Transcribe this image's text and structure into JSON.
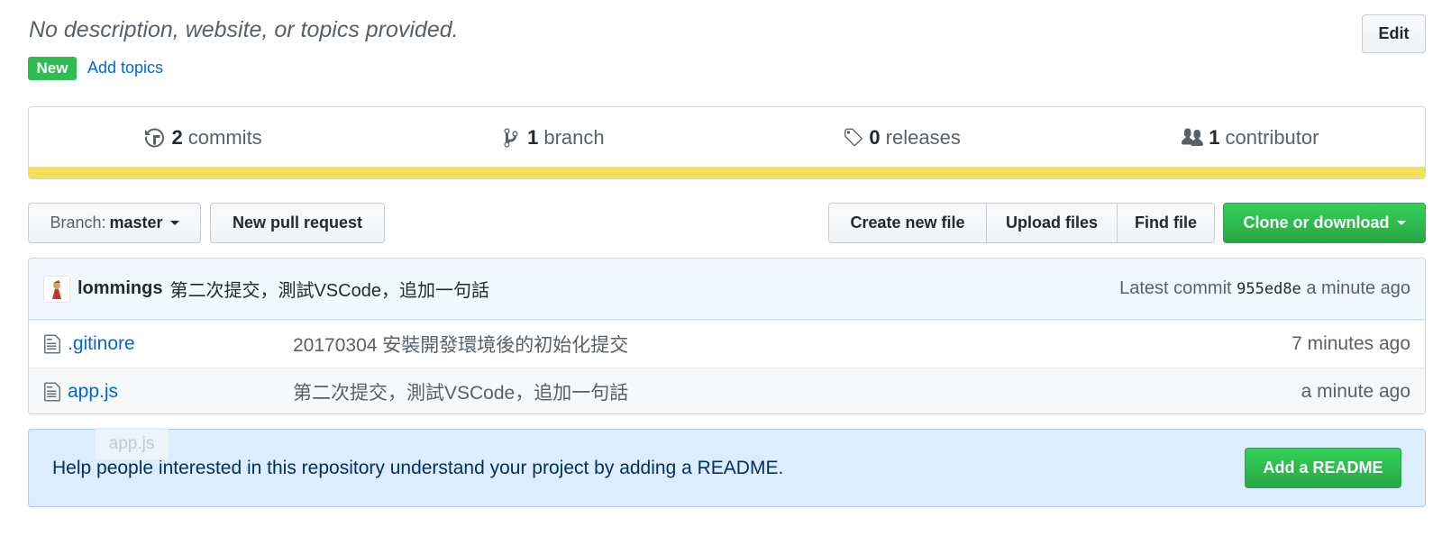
{
  "repo": {
    "description": "No description, website, or topics provided.",
    "edit_label": "Edit",
    "new_badge": "New",
    "add_topics": "Add topics"
  },
  "summary": {
    "commits": {
      "count": "2",
      "label": "commits",
      "icon": "history-icon"
    },
    "branches": {
      "count": "1",
      "label": "branch",
      "icon": "git-branch-icon"
    },
    "releases": {
      "count": "0",
      "label": "releases",
      "icon": "tag-icon"
    },
    "contributors": {
      "count": "1",
      "label": "contributor",
      "icon": "people-icon"
    },
    "language_color": "#f1e05a"
  },
  "toolbar": {
    "branch_prefix": "Branch:",
    "branch_name": "master",
    "new_pull_request": "New pull request",
    "create_new_file": "Create new file",
    "upload_files": "Upload files",
    "find_file": "Find file",
    "clone_or_download": "Clone or download"
  },
  "latest_commit": {
    "author": "lommings",
    "message": "第二次提交，測試VSCode，追加一句話",
    "prefix": "Latest commit",
    "sha": "955ed8e",
    "age": "a minute ago"
  },
  "files": [
    {
      "name": ".gitinore",
      "message": "20170304 安裝開發環境後的初始化提交",
      "age": "7 minutes ago"
    },
    {
      "name": "app.js",
      "message": "第二次提交，測試VSCode，追加一句話",
      "age": "a minute ago"
    }
  ],
  "drag_ghost": "app.js",
  "readme": {
    "text": "Help people interested in this repository understand your project by adding a README.",
    "button": "Add a README"
  },
  "colors": {
    "link": "#0366d6",
    "green": "#28a745",
    "readme_bg": "#dbedff"
  }
}
